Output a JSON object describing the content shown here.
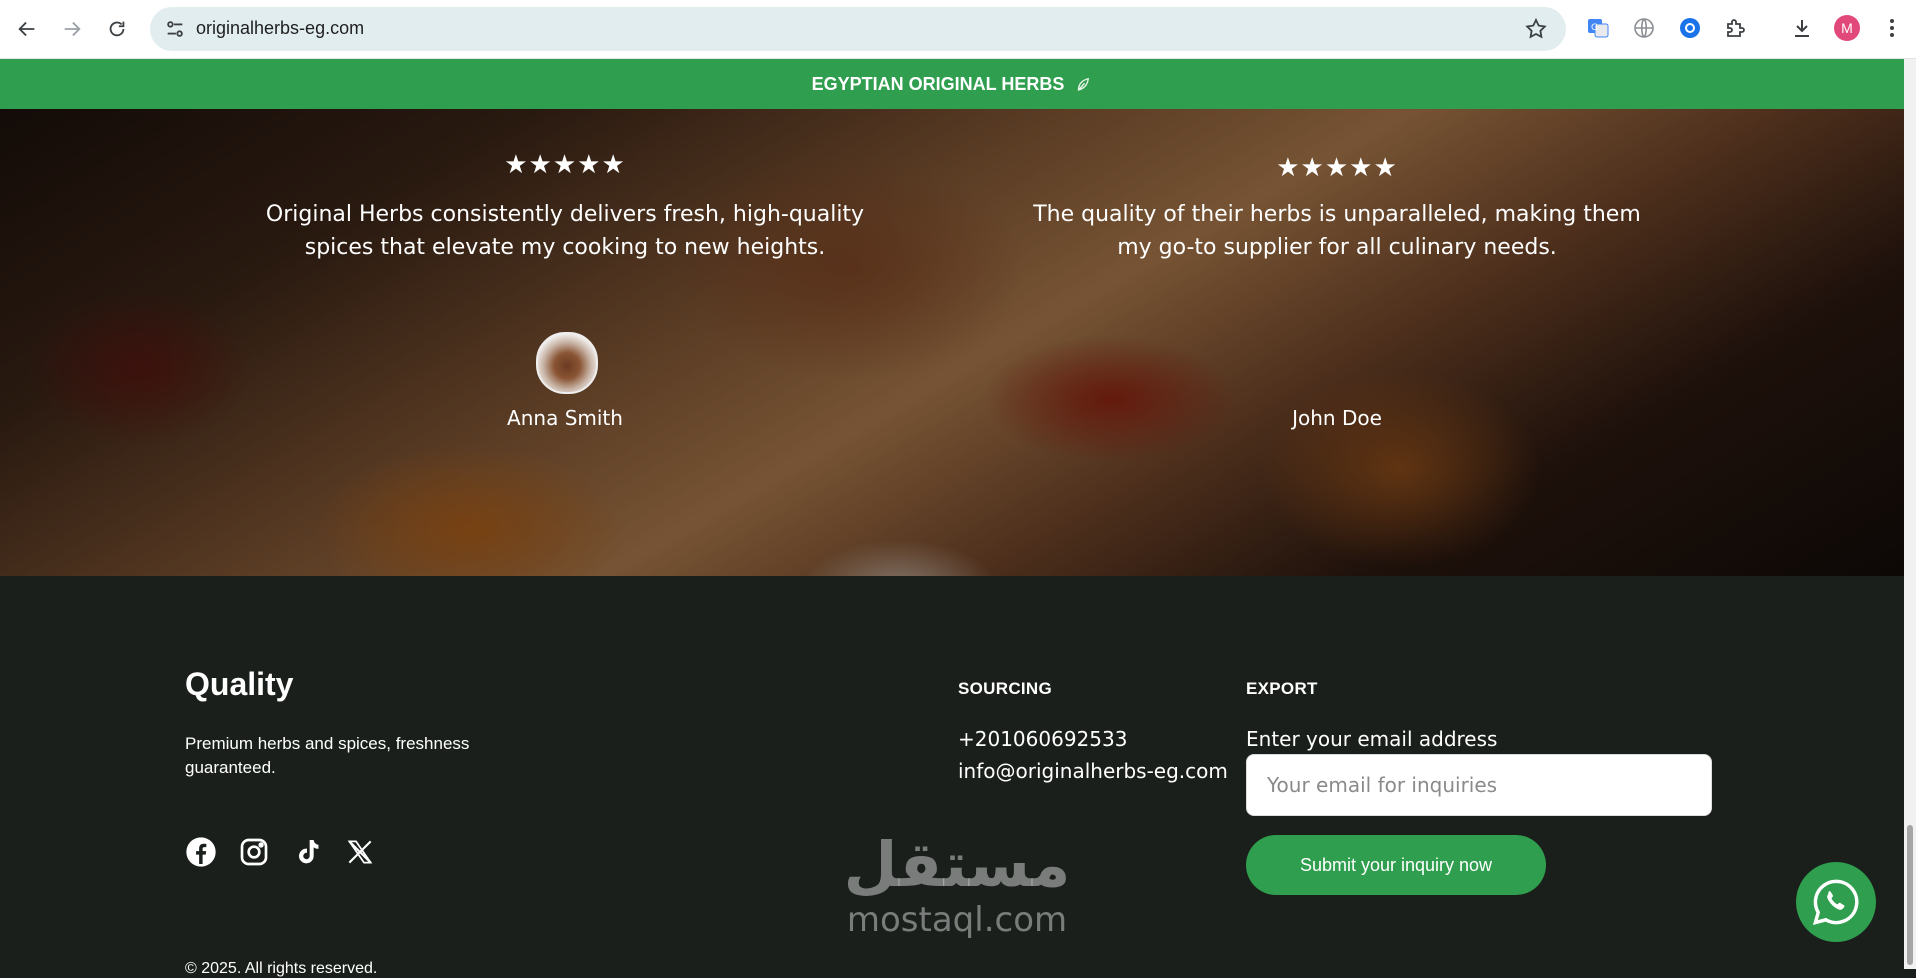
{
  "browser": {
    "url": "originalherbs-eg.com",
    "profile_initial": "M"
  },
  "banner": {
    "text": "EGYPTIAN ORIGINAL HERBS",
    "icon": "leaf-icon"
  },
  "testimonials": [
    {
      "rating": "★★★★★",
      "stars": 5,
      "quote": "Original Herbs consistently delivers fresh, high-quality spices that elevate my cooking to new heights.",
      "name": "Anna Smith",
      "has_avatar": true
    },
    {
      "rating": "★★★★★",
      "stars": 5,
      "quote": "The quality of their herbs is unparalleled, making them my go-to supplier for all culinary needs.",
      "name": "John Doe",
      "has_avatar": false
    }
  ],
  "footer": {
    "brand": "Quality",
    "tagline": "Premium herbs and spices, freshness guaranteed.",
    "social": [
      "facebook-icon",
      "instagram-icon",
      "tiktok-icon",
      "x-icon"
    ],
    "copyright": "© 2025. All rights reserved.",
    "sourcing": {
      "heading": "SOURCING",
      "phone": "+201060692533",
      "email": "info@originalherbs-eg.com"
    },
    "export": {
      "heading": "EXPORT",
      "email_label": "Enter your email address",
      "email_placeholder": "Your email for inquiries",
      "email_value": "",
      "submit_label": "Submit your inquiry now"
    }
  },
  "watermark": {
    "arabic": "مستقل",
    "latin": "mostaql.com"
  },
  "colors": {
    "brand_green": "#2f9e4e",
    "footer_bg": "#1a1f1b",
    "profile": "#e2497b"
  }
}
